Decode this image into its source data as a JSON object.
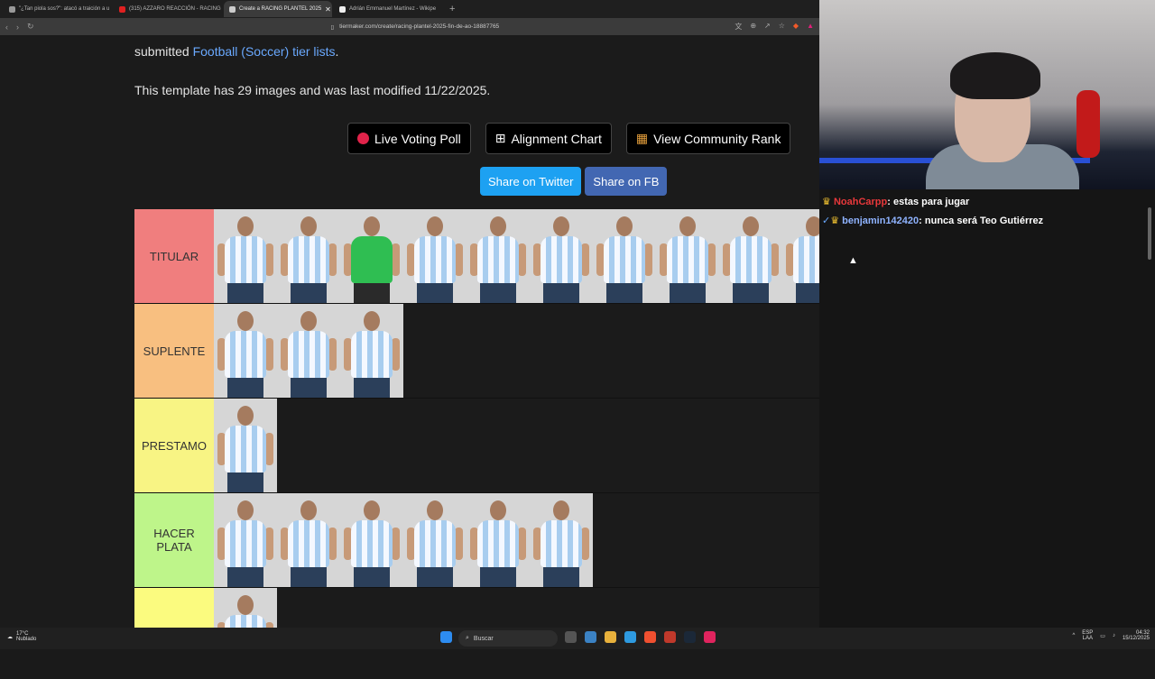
{
  "tabs": [
    {
      "title": "\"¿Tan piola sos?\": atacó a traición a u",
      "color": "#999",
      "active": false
    },
    {
      "title": "(315) AZZARO REACCIÓN - RACING",
      "color": "#e02020",
      "active": false
    },
    {
      "title": "Create a RACING PLANTEL 2025",
      "color": "#ccc",
      "active": true
    },
    {
      "title": "Adrián Emmanuel Martínez - Wikipe",
      "color": "#eee",
      "active": false
    }
  ],
  "browser": {
    "url": "tiermaker.com/create/racing-plantel-2025-fin-de-ao-18887765"
  },
  "page": {
    "line1_prefix": "submitted ",
    "line1_link": "Football (Soccer) tier lists",
    "line1_suffix": ".",
    "line2": "This template has 29 images and was last modified 11/22/2025.",
    "btn_live": "Live Voting Poll",
    "btn_align": "Alignment Chart",
    "btn_rank": "View Community Rank",
    "share_twitter": "Share on Twitter",
    "share_fb": "Share on FB"
  },
  "tiers": [
    {
      "label": "TITULAR",
      "color": "#f07e7e",
      "players": 10,
      "gk_index": 2
    },
    {
      "label": "SUPLENTE",
      "color": "#f8bf80",
      "players": 3,
      "gk_index": -1
    },
    {
      "label": "PRESTAMO",
      "color": "#f8f484",
      "players": 1,
      "gk_index": -1
    },
    {
      "label": "HACER PLATA",
      "color": "#bef58a",
      "players": 6,
      "gk_index": -1
    },
    {
      "label": "",
      "color": "#fbfb7f",
      "players": 1,
      "gk_index": -1
    }
  ],
  "chat": [
    {
      "user": "NoahCarpp",
      "text": "estas para jugar",
      "user_color": "#e8383b"
    },
    {
      "user": "benjamin142420",
      "text": "nunca será Teo Gutiérrez",
      "user_color": "#8fb3ff"
    }
  ],
  "taskbar": {
    "temp": "17°C",
    "weather": "Nublado",
    "search": "Buscar",
    "lang1": "ESP",
    "lang2": "LAA",
    "time": "04:32",
    "date": "15/12/2025"
  }
}
